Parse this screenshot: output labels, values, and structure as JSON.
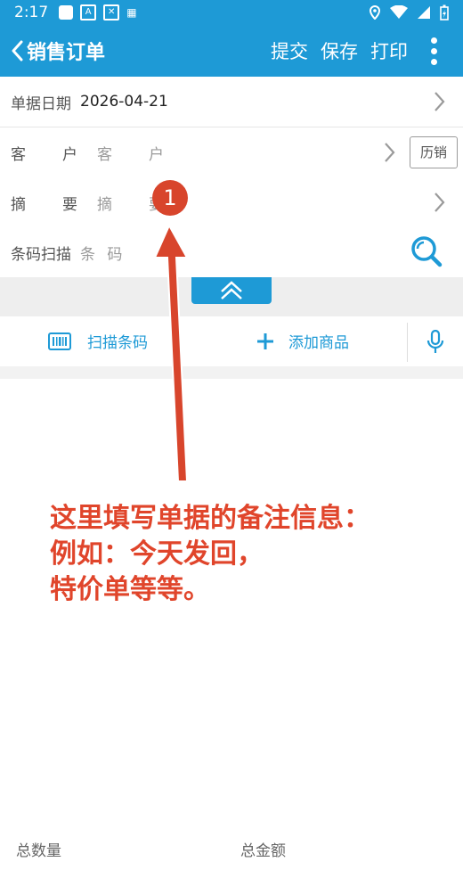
{
  "status_bar": {
    "time": "2:17"
  },
  "app_bar": {
    "title": "销售订单",
    "actions": [
      "提交",
      "保存",
      "打印"
    ]
  },
  "form": {
    "date": {
      "label": "单据日期",
      "value": "2026-04-21"
    },
    "customer": {
      "label": "客　户",
      "placeholder": "客　户",
      "history_button": "历销"
    },
    "memo": {
      "label": "摘　要",
      "placeholder": "摘　要"
    },
    "barcode": {
      "label": "条码扫描",
      "placeholder": "条 码"
    }
  },
  "toolbar": {
    "scan_label": "扫描条码",
    "add_label": "添加商品"
  },
  "footer": {
    "total_qty_label": "总数量",
    "total_amount_label": "总金额"
  },
  "annotation": {
    "step": "1",
    "lines": [
      "这里填写单据的备注信息：",
      "例如：今天发回，",
      "特价单等等。"
    ]
  },
  "colors": {
    "primary": "#1e9ad6",
    "annotation": "#e0452b"
  }
}
